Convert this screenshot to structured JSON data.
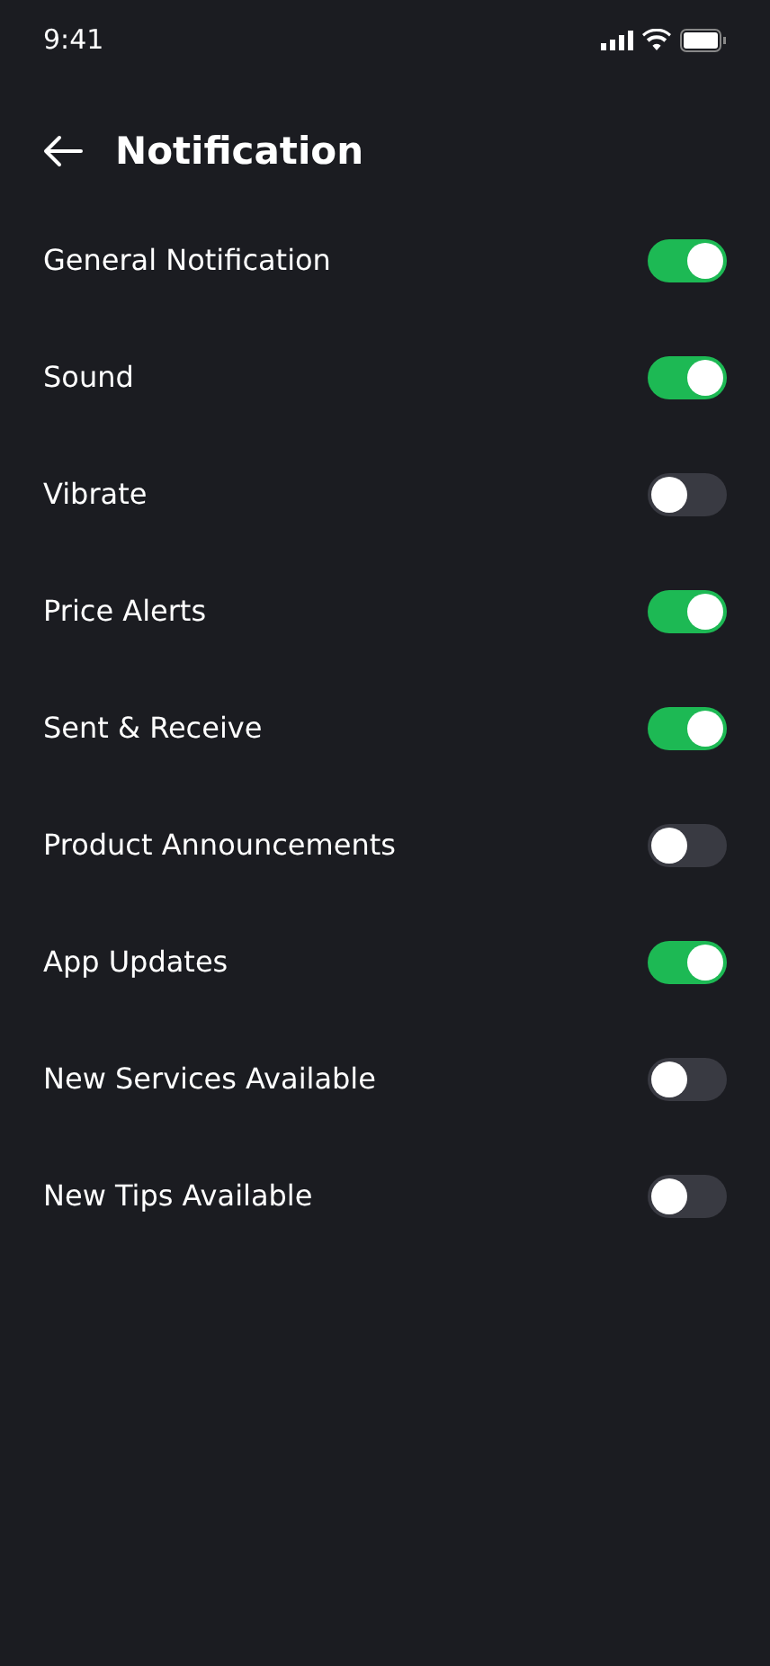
{
  "status_bar": {
    "time": "9:41"
  },
  "header": {
    "title": "Notification"
  },
  "settings": [
    {
      "label": "General Notification",
      "on": true
    },
    {
      "label": "Sound",
      "on": true
    },
    {
      "label": "Vibrate",
      "on": false
    },
    {
      "label": "Price Alerts",
      "on": true
    },
    {
      "label": "Sent & Receive",
      "on": true
    },
    {
      "label": "Product Announcements",
      "on": false
    },
    {
      "label": "App Updates",
      "on": true
    },
    {
      "label": "New Services Available",
      "on": false
    },
    {
      "label": "New Tips Available",
      "on": false
    }
  ]
}
